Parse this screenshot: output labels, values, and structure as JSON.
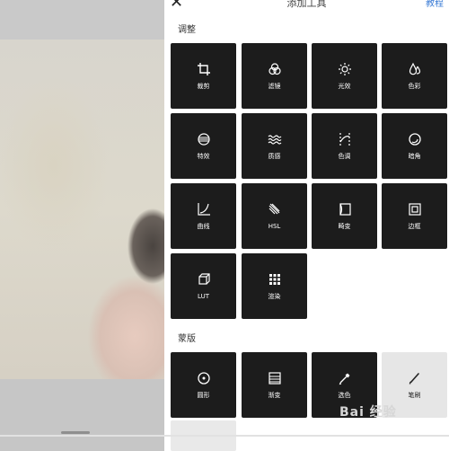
{
  "header": {
    "title": "添加工具",
    "tutorial_label": "教程"
  },
  "sections": {
    "adjust": "调整",
    "mask": "蒙版"
  },
  "tools": [
    {
      "label": "裁剪",
      "icon": "crop-icon"
    },
    {
      "label": "滤镜",
      "icon": "filter-icon"
    },
    {
      "label": "光效",
      "icon": "sun-icon"
    },
    {
      "label": "色彩",
      "icon": "droplets-icon"
    },
    {
      "label": "特效",
      "icon": "effect-icon"
    },
    {
      "label": "质感",
      "icon": "wave-icon"
    },
    {
      "label": "色调",
      "icon": "tone-icon"
    },
    {
      "label": "暗角",
      "icon": "vignette-icon"
    },
    {
      "label": "曲线",
      "icon": "curve-icon"
    },
    {
      "label": "HSL",
      "icon": "hsl-icon"
    },
    {
      "label": "畸变",
      "icon": "distortion-icon"
    },
    {
      "label": "边框",
      "icon": "frame-icon"
    },
    {
      "label": "LUT",
      "icon": "lut-icon"
    },
    {
      "label": "渲染",
      "icon": "grid-icon"
    }
  ],
  "masks": [
    {
      "label": "圆形",
      "icon": "circle-icon"
    },
    {
      "label": "渐变",
      "icon": "gradient-icon"
    },
    {
      "label": "选色",
      "icon": "eyedropper-icon"
    },
    {
      "label": "笔刷",
      "icon": "brush-icon"
    }
  ],
  "watermark": "Bai 经验",
  "colors": {
    "tile_bg": "#1c1c1c",
    "tile_selected_bg": "#e6e6e6",
    "accent": "#3a7bd5"
  }
}
